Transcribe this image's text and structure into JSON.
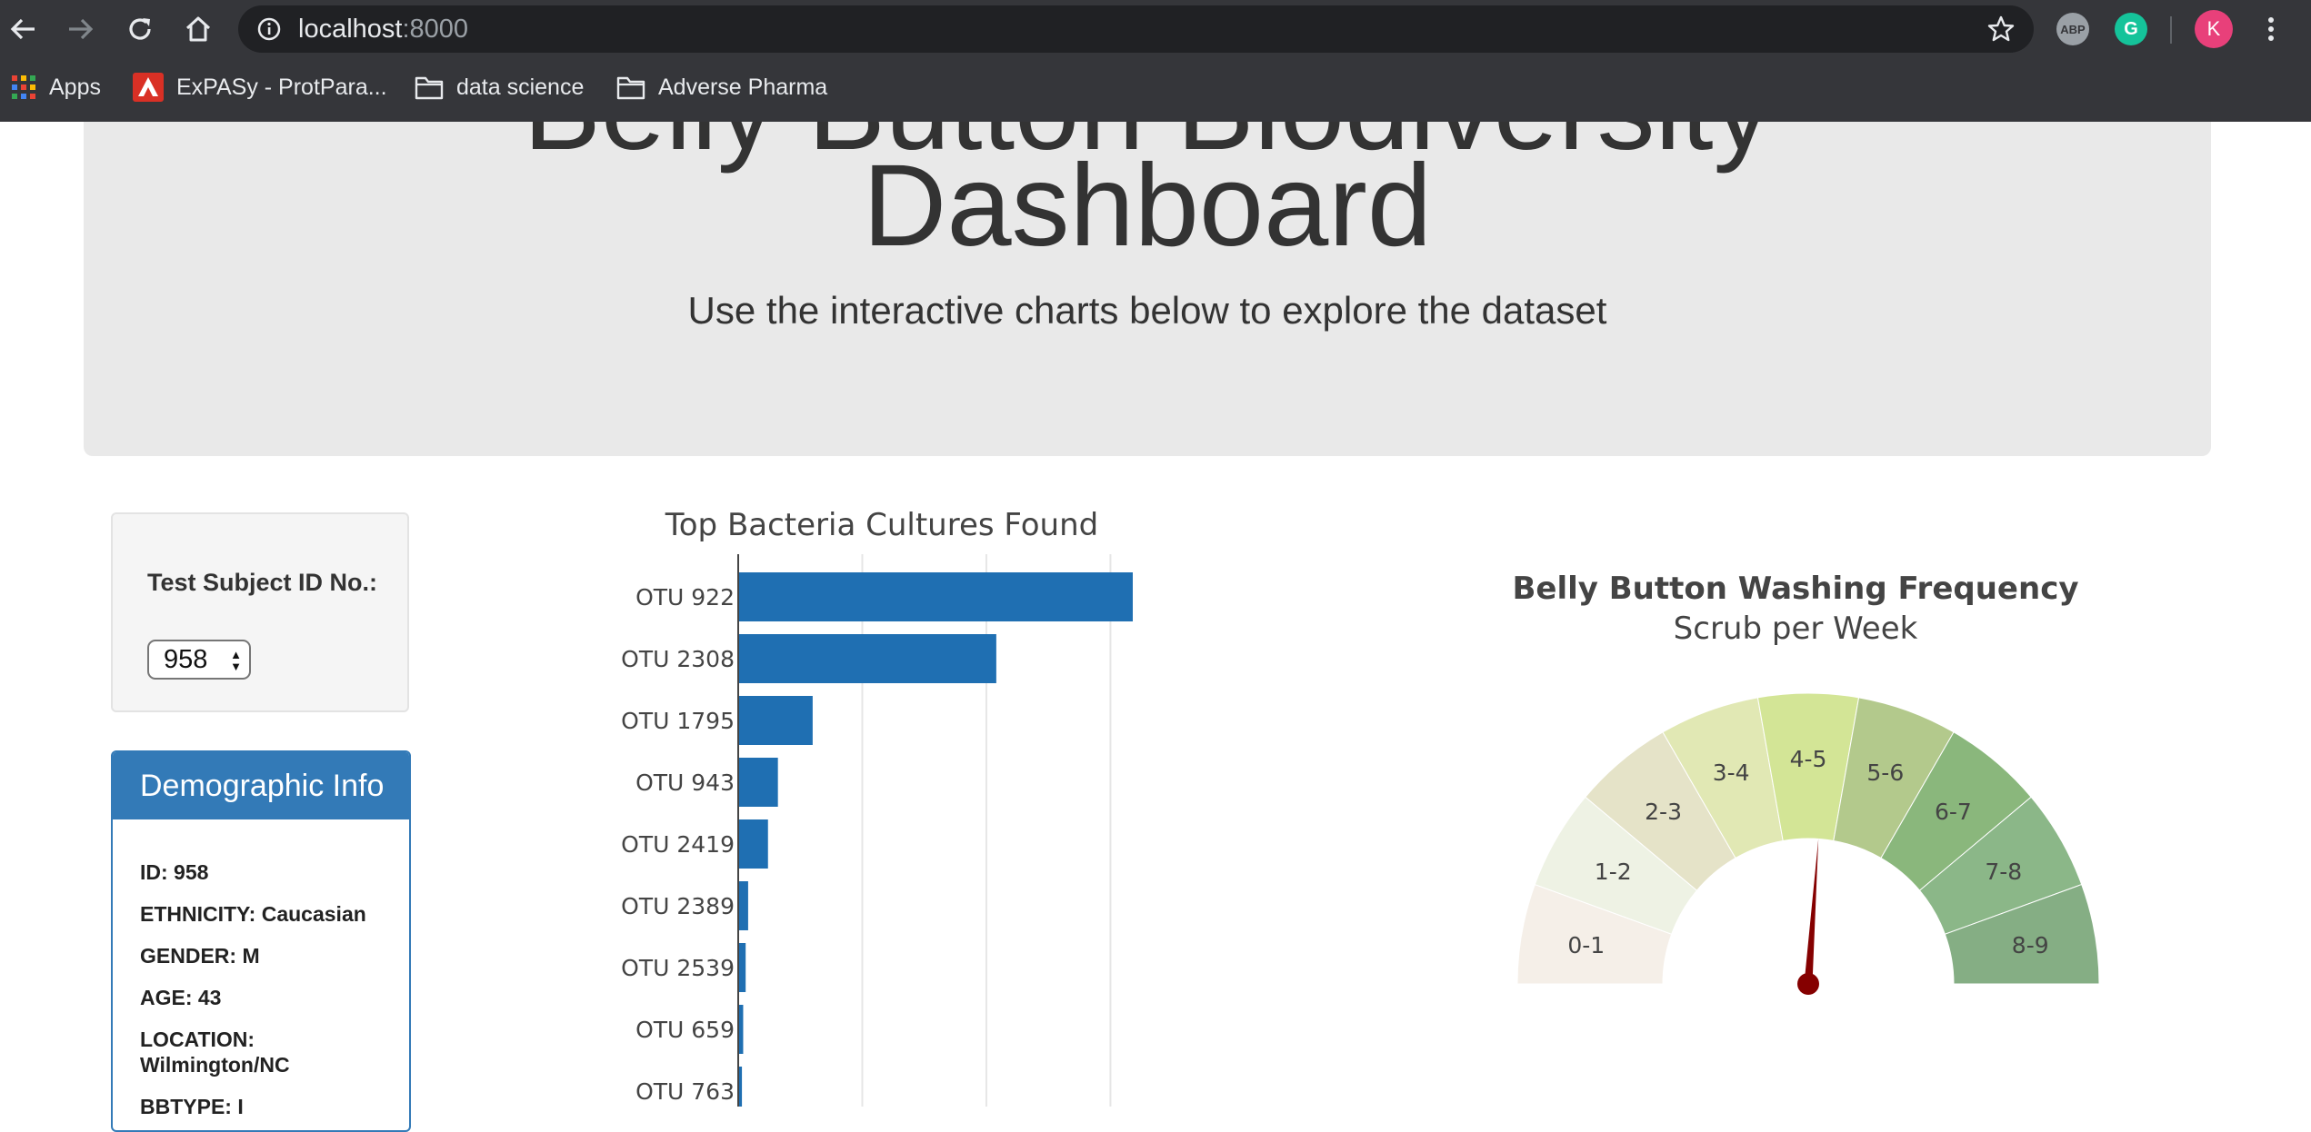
{
  "browser": {
    "url_host": "localhost",
    "url_port": ":8000",
    "bookmarks": [
      {
        "label": "Apps",
        "icon": "apps-grid-icon"
      },
      {
        "label": "ExPASy - ProtPara...",
        "icon": "expasy-icon"
      },
      {
        "label": "data science",
        "icon": "folder-icon"
      },
      {
        "label": "Adverse Pharma",
        "icon": "folder-icon"
      }
    ],
    "extensions": [
      {
        "label": "ABP",
        "icon": "adblock-plus-icon"
      },
      {
        "label": "G",
        "icon": "grammarly-icon"
      }
    ],
    "profile_initial": "K",
    "profile_color": "#e8407a"
  },
  "header": {
    "title_line1": "Belly Button Biodiversity",
    "title_line2": "Dashboard",
    "subtitle": "Use the interactive charts below to explore the dataset"
  },
  "selector": {
    "label": "Test Subject ID No.:",
    "selected": "958"
  },
  "demographics": {
    "heading": "Demographic Info",
    "items": [
      "ID: 958",
      "ETHNICITY: Caucasian",
      "GENDER: M",
      "AGE: 43",
      "LOCATION: Wilmington/NC",
      "BBTYPE: I"
    ]
  },
  "chart_data": [
    {
      "type": "bar",
      "orientation": "horizontal",
      "title": "Top Bacteria Cultures Found",
      "categories": [
        "OTU 922",
        "OTU 2308",
        "OTU 1795",
        "OTU 943",
        "OTU 2419",
        "OTU 2389",
        "OTU 2539",
        "OTU 659",
        "OTU 763"
      ],
      "values": [
        159,
        104,
        30,
        16,
        12,
        4,
        3,
        2,
        1.5
      ],
      "xlim": [
        0,
        220
      ],
      "grid": true,
      "color": "#1f6fb2"
    },
    {
      "type": "gauge",
      "title": "Belly Button Washing Frequency",
      "subtitle": "Scrub per Week",
      "segments": [
        "0-1",
        "1-2",
        "2-3",
        "3-4",
        "4-5",
        "5-6",
        "6-7",
        "7-8",
        "8-9"
      ],
      "segment_colors": [
        "#f5efe8",
        "#eef2e4",
        "#e5e3c8",
        "#e1e8b4",
        "#d3e596",
        "#b3c98c",
        "#8ab77c",
        "#8bb788",
        "#85ae84"
      ],
      "range": [
        0,
        9
      ],
      "value": 4.7,
      "needle_color": "#850000"
    }
  ]
}
